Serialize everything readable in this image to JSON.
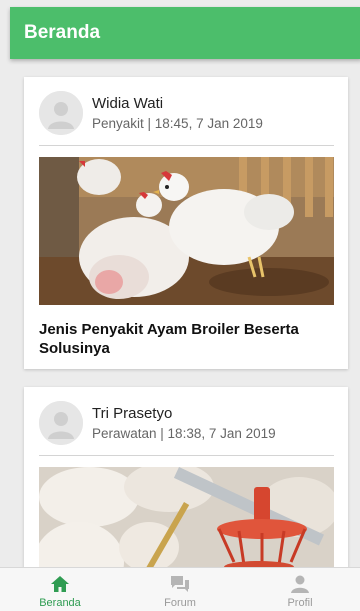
{
  "header": {
    "title": "Beranda"
  },
  "posts": [
    {
      "author": "Widia Wati",
      "meta": "Penyakit | 18:45, 7 Jan 2019",
      "title": "Jenis Penyakit Ayam Broiler Beserta Solusinya",
      "image_icon": "chickens-photo"
    },
    {
      "author": "Tri Prasetyo",
      "meta": "Perawatan | 18:38, 7 Jan 2019",
      "image_icon": "chicken-feeder-photo"
    }
  ],
  "nav": {
    "items": [
      {
        "label": "Beranda",
        "icon": "home-icon",
        "active": true
      },
      {
        "label": "Forum",
        "icon": "chat-icon",
        "active": false
      },
      {
        "label": "Profil",
        "icon": "user-icon",
        "active": false
      }
    ]
  },
  "colors": {
    "primary": "#4cbe6b",
    "active_nav": "#2f9c52",
    "inactive_nav": "#9a9a9a"
  }
}
